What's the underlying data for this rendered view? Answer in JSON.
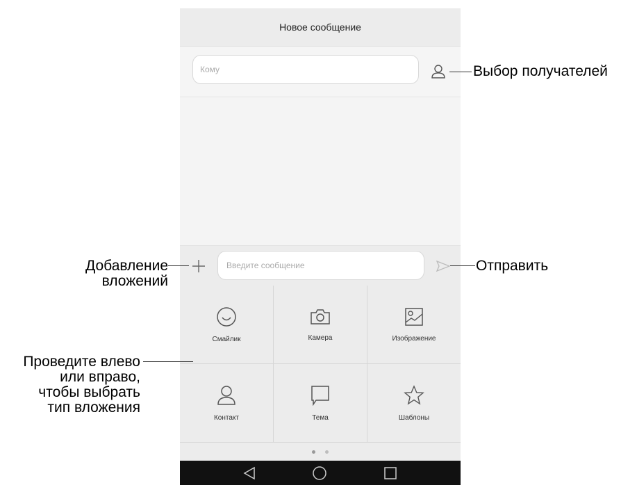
{
  "header": {
    "title": "Новое сообщение"
  },
  "to_field": {
    "placeholder": "Кому"
  },
  "compose": {
    "placeholder": "Введите сообщение"
  },
  "attachments": [
    {
      "label": "Смайлик",
      "icon": "smiley-icon"
    },
    {
      "label": "Камера",
      "icon": "camera-icon"
    },
    {
      "label": "Изображение",
      "icon": "image-icon"
    },
    {
      "label": "Контакт",
      "icon": "contact-icon"
    },
    {
      "label": "Тема",
      "icon": "subject-icon"
    },
    {
      "label": "Шаблоны",
      "icon": "star-icon"
    }
  ],
  "pager": {
    "pages": 2,
    "current": 1
  },
  "callouts": {
    "recipients": "Выбор получателей",
    "attachments_line1": "Добавление",
    "attachments_line2": "вложений",
    "send": "Отправить",
    "swipe_line1": "Проведите влево",
    "swipe_line2": "или вправо,",
    "swipe_line3": "чтобы выбрать",
    "swipe_line4": "тип вложения"
  },
  "colors": {
    "icon": "#555555",
    "navbar": "#111111",
    "panel": "#ececec"
  }
}
